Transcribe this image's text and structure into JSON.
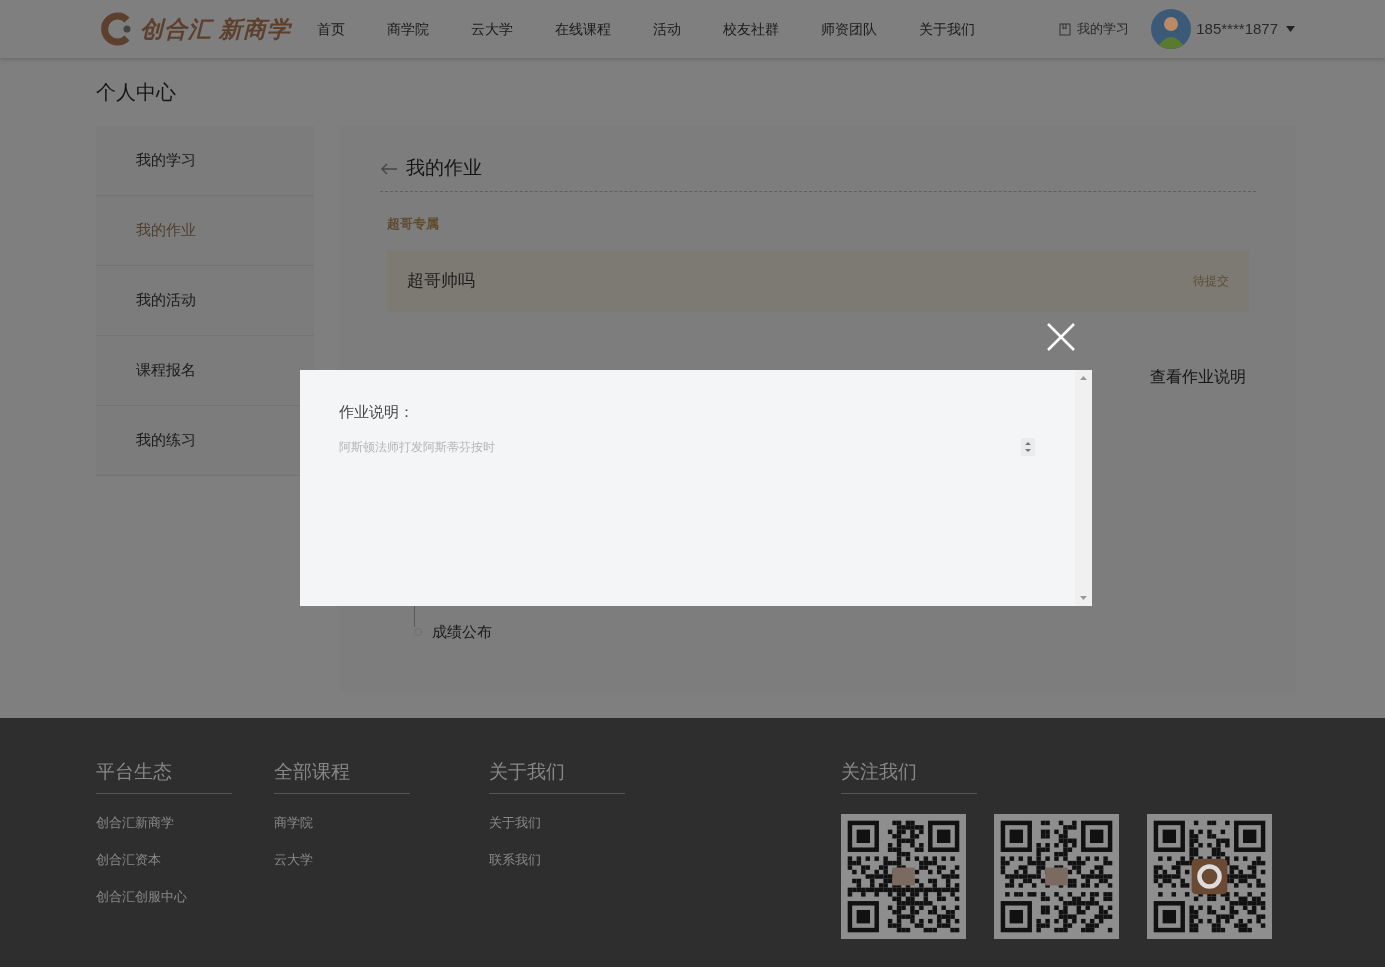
{
  "header": {
    "logo_text": "创合汇 新商学",
    "nav": [
      {
        "label": "首页"
      },
      {
        "label": "商学院"
      },
      {
        "label": "云大学"
      },
      {
        "label": "在线课程"
      },
      {
        "label": "活动"
      },
      {
        "label": "校友社群"
      },
      {
        "label": "师资团队"
      },
      {
        "label": "关于我们"
      }
    ],
    "my_study": "我的学习",
    "user": {
      "phone": "185****1877"
    }
  },
  "page_title": "个人中心",
  "sidebar": [
    {
      "label": "我的学习",
      "selected": false
    },
    {
      "label": "我的作业",
      "selected": true
    },
    {
      "label": "我的活动",
      "selected": false
    },
    {
      "label": "课程报名",
      "selected": false
    },
    {
      "label": "我的练习",
      "selected": false
    }
  ],
  "panel": {
    "title": "我的作业",
    "group": "超哥专属",
    "assignment": {
      "title": "超哥帅吗",
      "status": "待提交"
    },
    "link": "查看作业说明",
    "timeline": [
      {
        "label": "成绩公布"
      }
    ]
  },
  "modal": {
    "label": "作业说明：",
    "placeholder": "阿斯顿法师打发阿斯蒂芬按时"
  },
  "footer": {
    "columns": [
      {
        "title": "平台生态",
        "links": [
          "创合汇新商学",
          "创合汇资本",
          "创合汇创服中心"
        ]
      },
      {
        "title": "全部课程",
        "links": [
          "商学院",
          "云大学"
        ]
      },
      {
        "title": "关于我们",
        "links": [
          "关于我们",
          "联系我们"
        ]
      }
    ],
    "follow": {
      "title": "关注我们",
      "qr_codes": [
        {
          "kind": "qr"
        },
        {
          "kind": "qr"
        },
        {
          "kind": "qr_logo"
        }
      ]
    }
  }
}
